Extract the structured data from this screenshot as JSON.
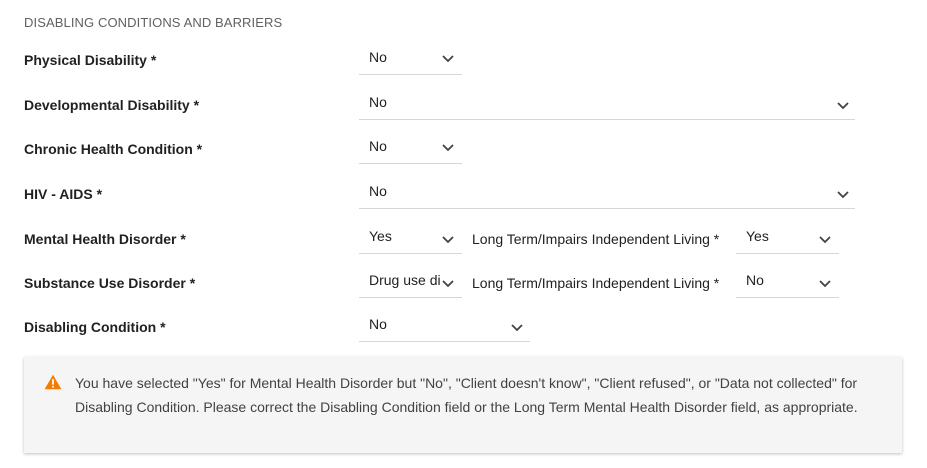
{
  "section": {
    "title": "DISABLING CONDITIONS AND BARRIERS"
  },
  "fields": {
    "physical_disability": {
      "label": "Physical Disability *",
      "value": "No"
    },
    "developmental_disability": {
      "label": "Developmental Disability *",
      "value": "No"
    },
    "chronic_health_condition": {
      "label": "Chronic Health Condition *",
      "value": "No"
    },
    "hiv_aids": {
      "label": "HIV - AIDS *",
      "value": "No"
    },
    "mental_health_disorder": {
      "label": "Mental Health Disorder *",
      "value": "Yes",
      "long_term_label": "Long Term/Impairs Independent Living *",
      "long_term_value": "Yes"
    },
    "substance_use_disorder": {
      "label": "Substance Use Disorder *",
      "value": "Drug use di",
      "long_term_label": "Long Term/Impairs Independent Living *",
      "long_term_value": "No"
    },
    "disabling_condition": {
      "label": "Disabling Condition *",
      "value": "No"
    }
  },
  "alert": {
    "icon": "warning-triangle-icon",
    "message": "You have selected \"Yes\" for Mental Health Disorder but \"No\", \"Client doesn't know\", \"Client refused\", or \"Data not collected\" for Disabling Condition. Please correct the Disabling Condition field or the Long Term Mental Health Disorder field, as appropriate."
  },
  "colors": {
    "warning": "#f57c00",
    "underline": "#d6d6d6",
    "alert_background": "#f5f5f5"
  }
}
